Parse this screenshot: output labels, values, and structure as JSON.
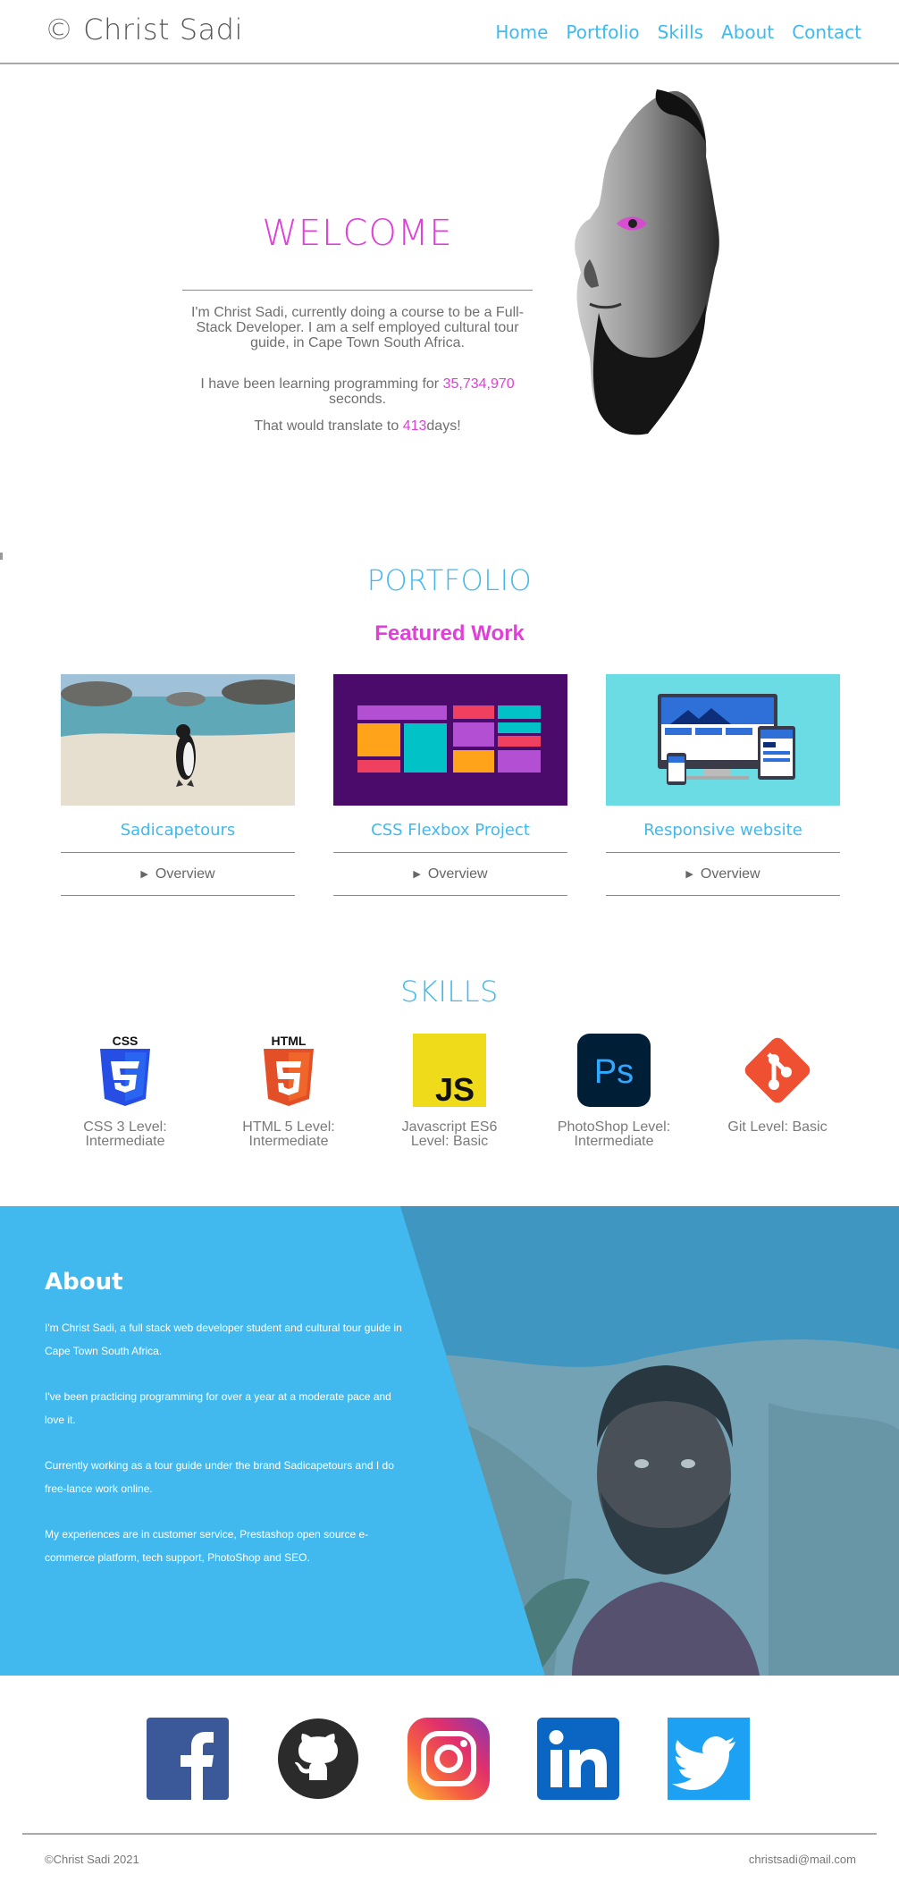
{
  "header": {
    "brand": "© Christ Sadi",
    "nav": [
      "Home",
      "Portfolio",
      "Skills",
      "About",
      "Contact"
    ]
  },
  "hero": {
    "title": "WELCOME",
    "intro": "I'm Christ Sadi, currently doing a course to be a Full-Stack Developer. I am a self employed cultural tour guide, in Cape Town South Africa.",
    "seconds_prefix": "I have been learning programming for",
    "seconds_value": "35,734,970",
    "seconds_suffix": "seconds.",
    "days_prefix": "That would translate to",
    "days_value": "413",
    "days_suffix": "days!"
  },
  "portfolio": {
    "title": "PORTFOLIO",
    "subtitle": "Featured Work",
    "cards": [
      {
        "title": "Sadicapetours",
        "details": "Overview"
      },
      {
        "title": "CSS Flexbox Project",
        "details": "Overview"
      },
      {
        "title": "Responsive website",
        "details": "Overview"
      }
    ]
  },
  "skills": {
    "title": "SKILLS",
    "items": [
      {
        "icon": "css3-icon",
        "label": "CSS 3 Level: Intermediate",
        "badge": "CSS"
      },
      {
        "icon": "html5-icon",
        "label": "HTML 5 Level: Intermediate",
        "badge": "HTML"
      },
      {
        "icon": "javascript-icon",
        "label": "Javascript ES6 Level: Basic",
        "badge": "JS"
      },
      {
        "icon": "photoshop-icon",
        "label": "PhotoShop Level: Intermediate",
        "badge": "Ps"
      },
      {
        "icon": "git-icon",
        "label": "Git Level: Basic"
      }
    ]
  },
  "about": {
    "title": "About",
    "paragraphs": [
      "I'm Christ Sadi, a full stack web developer student and cultural tour guide in Cape Town South Africa.",
      "I've been practicing programming for over a year at a moderate pace and love it.",
      "Currently working as a tour guide under the brand Sadicapetours and I do free-lance work online.",
      "My experiences are in customer service, Prestashop open source e-commerce platform, tech support, PhotoShop and SEO."
    ]
  },
  "social": [
    "facebook-icon",
    "github-icon",
    "instagram-icon",
    "linkedin-icon",
    "twitter-icon"
  ],
  "footer": {
    "copyright": "©Christ Sadi 2021",
    "email": "christsadi@mail.com"
  },
  "colors": {
    "accent_blue": "#41b9ee",
    "accent_pink": "#e03fd8",
    "about_bg": "#41b9ee"
  }
}
